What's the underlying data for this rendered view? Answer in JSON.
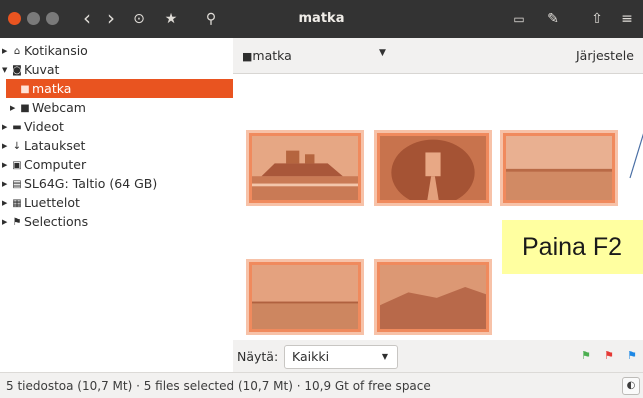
{
  "window": {
    "title": "matka",
    "controls": [
      "close-icon",
      "minimize-icon",
      "maximize-icon"
    ],
    "accent_color": "#e95420"
  },
  "toolbar": {
    "back": "‹",
    "forward": "›",
    "history": "⊙",
    "favorites": "★",
    "search": "⚲",
    "export": "▭",
    "tools": "✎",
    "share": "⇧",
    "menu": "≡"
  },
  "sidebar": {
    "items": [
      {
        "label": "Kotikansio",
        "icon": "home-icon"
      },
      {
        "label": "Kuvat",
        "icon": "camera-icon"
      },
      {
        "label": "matka",
        "icon": "folder-icon",
        "selected": true
      },
      {
        "label": "Webcam",
        "icon": "folder-icon"
      },
      {
        "label": "Videot",
        "icon": "video-icon"
      },
      {
        "label": "Lataukset",
        "icon": "download-icon"
      },
      {
        "label": "Computer",
        "icon": "computer-icon"
      },
      {
        "label": "SL64G: Taltio (64 GB)",
        "icon": "drive-icon"
      },
      {
        "label": "Luettelot",
        "icon": "catalog-icon"
      },
      {
        "label": "Selections",
        "icon": "flag-icon"
      }
    ]
  },
  "main": {
    "path": "matka",
    "sort_label": "Järjestele",
    "hint": "Paina F2",
    "thumbnails": [
      {
        "name": "thumbnail-1",
        "scene": "ship"
      },
      {
        "name": "thumbnail-2",
        "scene": "tunnel"
      },
      {
        "name": "thumbnail-3",
        "scene": "desert"
      },
      {
        "name": "thumbnail-4",
        "scene": "coast"
      },
      {
        "name": "thumbnail-5",
        "scene": "hills"
      }
    ]
  },
  "footer": {
    "show_label": "Näytä:",
    "filter_value": "Kaikki",
    "flag_colors": [
      "#4caf50",
      "#e53935",
      "#1e88e5"
    ]
  },
  "status": {
    "text": "5 tiedostoa (10,7 Mt) · 5 files selected (10,7 Mt) · 10,9 Gt of free space"
  }
}
